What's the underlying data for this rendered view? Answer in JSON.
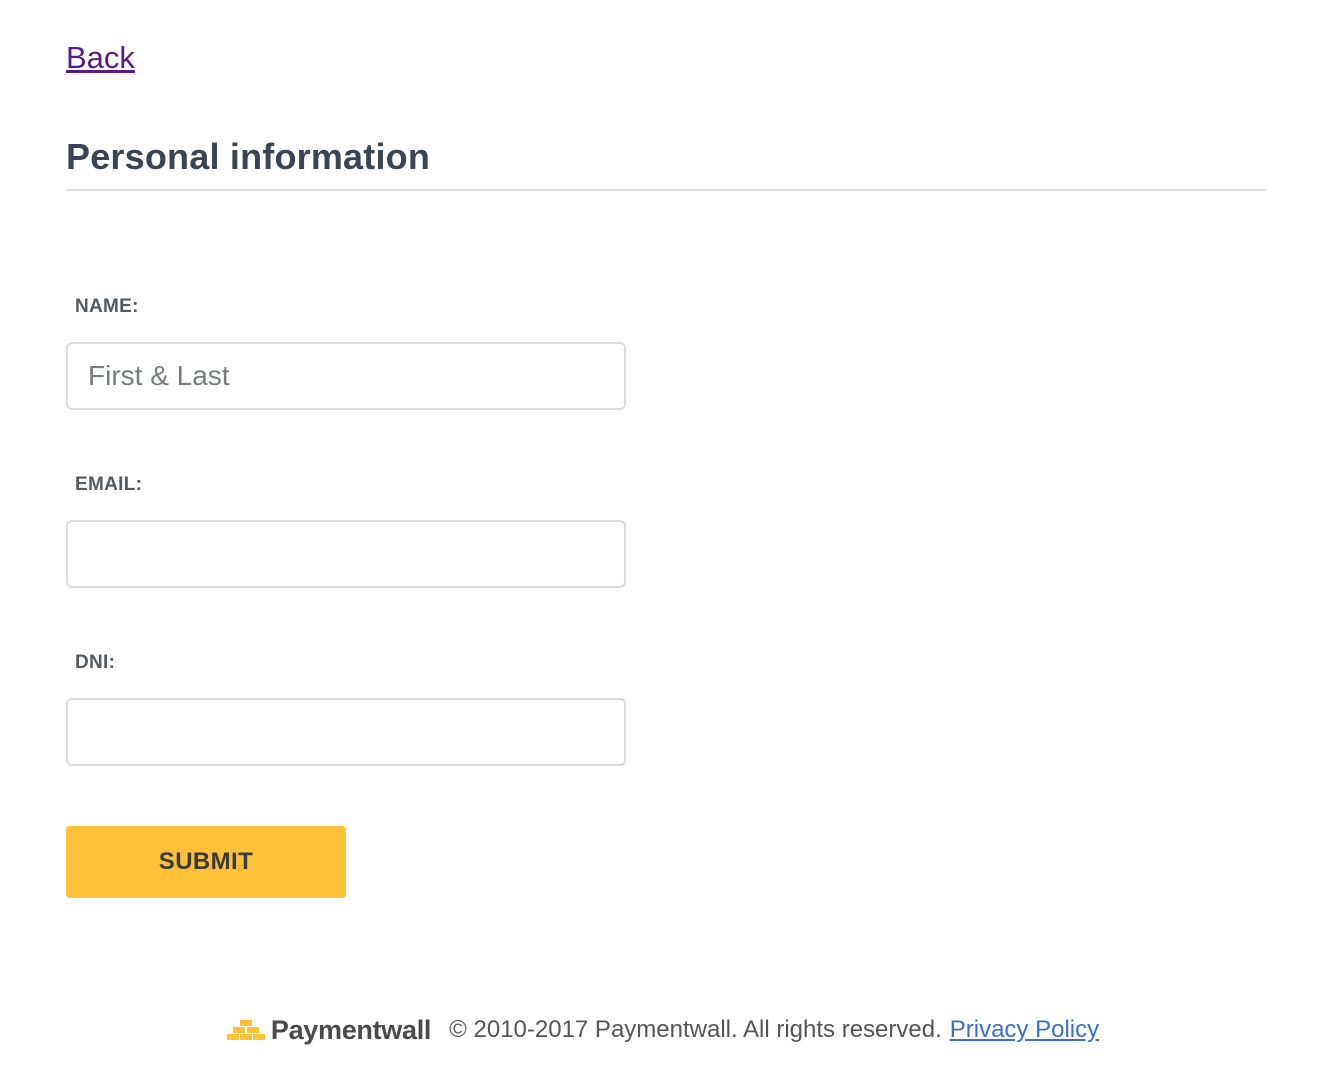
{
  "nav": {
    "back_label": "Back"
  },
  "header": {
    "title": "Personal information"
  },
  "form": {
    "name": {
      "label": "NAME:",
      "placeholder": "First & Last",
      "value": ""
    },
    "email": {
      "label": "EMAIL:",
      "placeholder": "",
      "value": ""
    },
    "dni": {
      "label": "DNI:",
      "placeholder": "",
      "value": ""
    },
    "submit_label": "SUBMIT"
  },
  "footer": {
    "brand_name": "Paymentwall",
    "brand_icon": "paymentwall-logo-icon",
    "copyright": "© 2010-2017 Paymentwall. All rights reserved.",
    "privacy_label": "Privacy Policy"
  },
  "colors": {
    "accent": "#ffc13a",
    "link_visited": "#5a1a8a",
    "link": "#3a6fd0",
    "heading": "#3b4455"
  }
}
